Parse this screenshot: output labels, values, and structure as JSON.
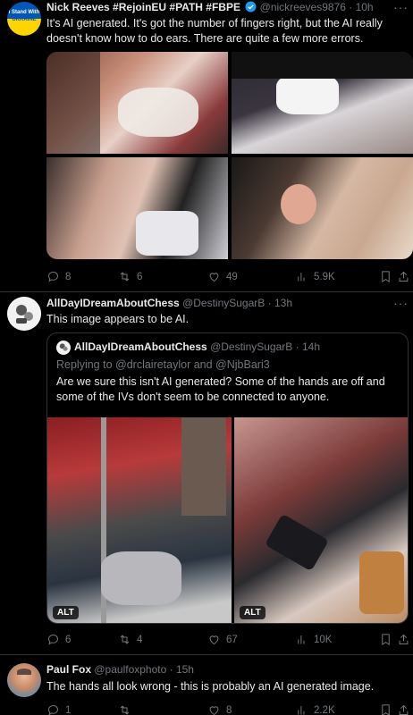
{
  "tweet1": {
    "badge_line1": "I Stand With",
    "badge_line2": "UKRAINE",
    "name": "Nick Reeves #RejoinEU #PATH #FBPE",
    "handle": "@nickreeves9876",
    "time": "· 10h",
    "text": "It's AI generated. It's got the number of fingers right, but the AI really doesn't know how to do ears. There are quite a few more errors.",
    "replies": "8",
    "retweets": "6",
    "likes": "49",
    "views": "5.9K"
  },
  "tweet2": {
    "name": "AllDayIDreamAboutChess",
    "handle": "@DestinySugarB",
    "time": "· 13h",
    "text": "This image appears to be AI.",
    "replies": "6",
    "retweets": "4",
    "likes": "67",
    "views": "10K",
    "quote": {
      "name": "AllDayIDreamAboutChess",
      "handle": "@DestinySugarB",
      "time": "· 14h",
      "replying": "Replying to @drclairetaylor and @NjbBari3",
      "text": "Are we sure this isn't AI generated? Some of the hands are off and some of the IVs don't seem to be connected to anyone.",
      "alt_label": "ALT"
    }
  },
  "tweet3": {
    "name": "Paul Fox",
    "handle": "@paulfoxphoto",
    "time": "· 15h",
    "text": "The hands all look wrong - this is probably an AI generated image.",
    "replies": "1",
    "likes": "8",
    "views": "2.2K"
  },
  "more_label": "···",
  "colors": {
    "background": "#000000",
    "text": "#e7e9ea",
    "muted": "#71767b",
    "verified": "#1d9bf0",
    "divider": "#2f3336"
  }
}
